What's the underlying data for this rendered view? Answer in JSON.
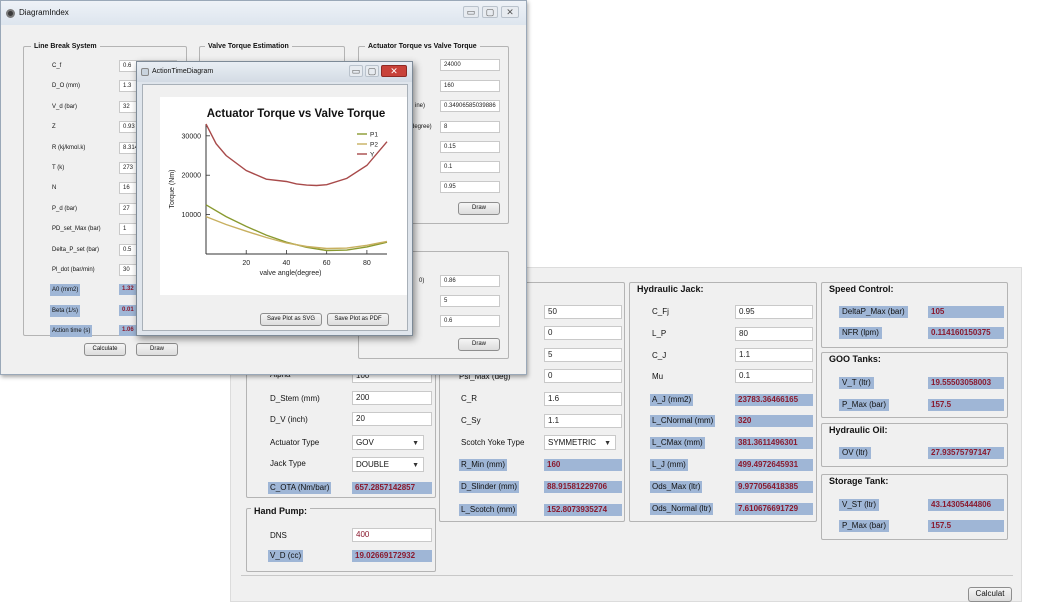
{
  "calc": {
    "motor": {
      "rows": [
        {
          "label": "Alpha",
          "value": "100"
        },
        {
          "label": "D_Stem (mm)",
          "value": "200"
        },
        {
          "label": "D_V (inch)",
          "value": "20"
        }
      ],
      "actuator_type": {
        "label": "Actuator Type",
        "value": "GOV"
      },
      "jack_type": {
        "label": "Jack Type",
        "value": "DOUBLE"
      },
      "c_ota": {
        "label": "C_OTA (Nm/bar)",
        "value": "657.2857142857"
      }
    },
    "hand_pump": {
      "title": "Hand Pump:",
      "dns_label": "DNS",
      "dns_value": "400",
      "vd_label": "V_D (cc)",
      "vd_value": "19.02669172932"
    },
    "scotch": {
      "inputs": [
        "50",
        "0",
        "5",
        "0"
      ],
      "psi_label": "Psi_Max (deg)",
      "rows": [
        {
          "label": "C_R",
          "value": "1.6"
        },
        {
          "label": "C_Sy",
          "value": "1.1"
        }
      ],
      "yoke": {
        "label": "Scotch Yoke Type",
        "value": "SYMMETRIC"
      },
      "outputs": [
        {
          "label": "R_Min (mm)",
          "value": "160"
        },
        {
          "label": "D_Slinder (mm)",
          "value": "88.91581229706"
        },
        {
          "label": "L_Scotch (mm)",
          "value": "152.8073935274"
        }
      ]
    },
    "jack": {
      "title": "Hydraulic Jack:",
      "inputs": [
        {
          "label": "C_Fj",
          "value": "0.95"
        },
        {
          "label": "L_P",
          "value": "80"
        },
        {
          "label": "C_J",
          "value": "1.1"
        },
        {
          "label": "Mu",
          "value": "0.1"
        }
      ],
      "outputs": [
        {
          "label": "A_J (mm2)",
          "value": "23783.36466165"
        },
        {
          "label": "L_CNormal (mm)",
          "value": "320"
        },
        {
          "label": "L_CMax (mm)",
          "value": "381.3611496301"
        },
        {
          "label": "L_J (mm)",
          "value": "499.4972645931"
        },
        {
          "label": "Ods_Max (ltr)",
          "value": "9.977056418385"
        },
        {
          "label": "Ods_Normal (ltr)",
          "value": "7.610676691729"
        }
      ]
    },
    "speed": {
      "title": "Speed Control:",
      "rows": [
        {
          "label": "DeltaP_Max (bar)",
          "value": "105"
        },
        {
          "label": "NFR (lpm)",
          "value": "0.114160150375"
        }
      ]
    },
    "goo": {
      "title": "GOO Tanks:",
      "rows": [
        {
          "label": "V_T (ltr)",
          "value": "19.55503058003"
        },
        {
          "label": "P_Max (bar)",
          "value": "157.5"
        }
      ]
    },
    "oil": {
      "title": "Hydraulic Oil:",
      "rows": [
        {
          "label": "OV (ltr)",
          "value": "27.93575797147"
        }
      ]
    },
    "storage": {
      "title": "Storage Tank:",
      "rows": [
        {
          "label": "V_ST (ltr)",
          "value": "43.14305444806"
        },
        {
          "label": "P_Max (bar)",
          "value": "157.5"
        }
      ]
    },
    "calculate_label": "Calculat"
  },
  "diag": {
    "title": "DiagramIndex",
    "titlebar_btns": [
      "▭",
      "▢",
      "✕"
    ],
    "line_break": {
      "title": "Line Break System",
      "rows": [
        {
          "label": "C_f",
          "value": "0.6"
        },
        {
          "label": "D_O (mm)",
          "value": "1.3"
        },
        {
          "label": "V_d (bar)",
          "value": "32"
        },
        {
          "label": "Z",
          "value": "0.93"
        },
        {
          "label": "R (kj/kmol.k)",
          "value": "8.314"
        },
        {
          "label": "T (k)",
          "value": "273"
        },
        {
          "label": "N",
          "value": "16"
        },
        {
          "label": "P_d (bar)",
          "value": "27"
        },
        {
          "label": "PD_set_Max (bar)",
          "value": "1"
        },
        {
          "label": "Delta_P_set (bar)",
          "value": "0.5"
        },
        {
          "label": "Pl_dot (bar/min)",
          "value": "30"
        }
      ],
      "outputs": [
        {
          "label": "A0 (mm2)",
          "value": "1.32"
        },
        {
          "label": "Beta (1/s)",
          "value": "0.01"
        },
        {
          "label": "Action time (s)",
          "value": "1.06"
        }
      ]
    },
    "valve_torque": {
      "title": "Valve Torque Estimation"
    },
    "act_vs_valve": {
      "title": "Actuator Torque vs Valve Torque",
      "values": [
        "24000",
        "160",
        "0.34906585039886",
        "8",
        "0.15",
        "0.1",
        "0.95"
      ],
      "row3_label": "ine)",
      "row4_label": "degree)"
    },
    "lower_group": {
      "values": [
        "0.86",
        "5",
        "0.6"
      ],
      "row0_label": "0)"
    },
    "buttons": {
      "calculate": "Calculate",
      "draw": "Draw",
      "draw_right": "Draw",
      "draw_bottom": "Draw"
    }
  },
  "atd": {
    "title": "ActionTimeDiagram",
    "titlebar_btns": [
      "▭",
      "▢",
      "✕"
    ],
    "save_svg": "Save Plot as SVG",
    "save_pdf": "Save Plot as PDF",
    "colors": {
      "p1": "#8a9a30",
      "p2": "#c8b060",
      "y": "#a84a4a"
    }
  },
  "chart_data": {
    "type": "line",
    "title": "Actuator Torque vs Valve Torque",
    "xlabel": "valve angle(degree)",
    "ylabel": "Torque (Nm)",
    "xlim": [
      0,
      90
    ],
    "ylim": [
      0,
      33000
    ],
    "xticks": [
      20,
      40,
      60,
      80
    ],
    "yticks": [
      10000,
      20000,
      30000
    ],
    "legend_position": "top-right",
    "series": [
      {
        "name": "P1",
        "x": [
          0,
          10,
          20,
          30,
          40,
          50,
          60,
          70,
          80,
          90
        ],
        "y": [
          12500,
          9500,
          7000,
          4800,
          3000,
          1700,
          900,
          1000,
          1800,
          3000
        ]
      },
      {
        "name": "P2",
        "x": [
          0,
          10,
          20,
          30,
          40,
          50,
          60,
          70,
          80,
          90
        ],
        "y": [
          9500,
          7500,
          5800,
          4200,
          2800,
          1900,
          1400,
          1500,
          2200,
          3200
        ]
      },
      {
        "name": "Y",
        "x": [
          0,
          5,
          10,
          20,
          30,
          40,
          45,
          50,
          55,
          60,
          70,
          80,
          90
        ],
        "y": [
          33000,
          28000,
          25000,
          21200,
          19000,
          18400,
          17800,
          17500,
          17400,
          17600,
          19200,
          22500,
          28500
        ]
      }
    ]
  }
}
